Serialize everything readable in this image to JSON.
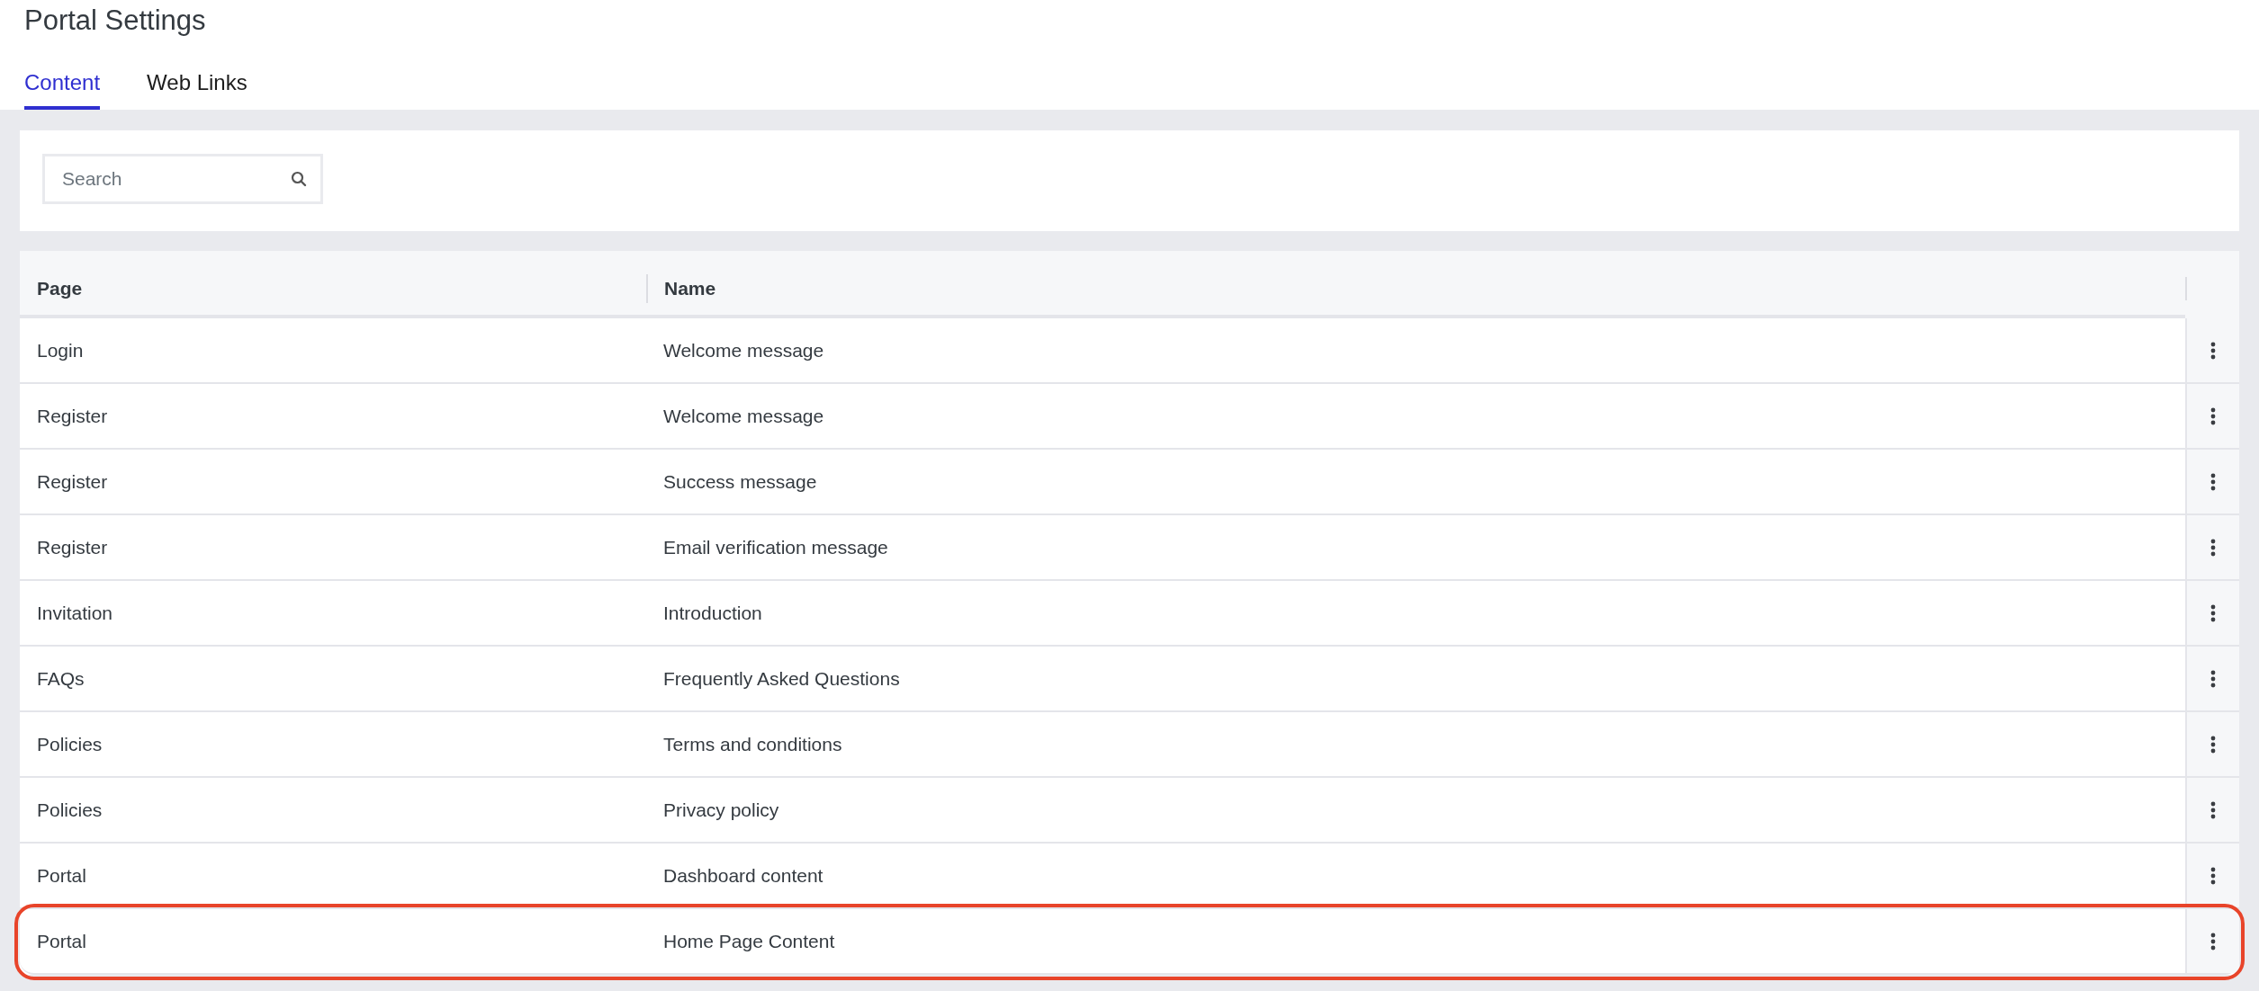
{
  "title": "Portal Settings",
  "tabs": [
    {
      "label": "Content",
      "selected": true
    },
    {
      "label": "Web Links",
      "selected": false
    }
  ],
  "search": {
    "placeholder": "Search"
  },
  "table": {
    "columns": [
      "Page",
      "Name"
    ],
    "rows": [
      {
        "page": "Login",
        "name": "Welcome message",
        "highlighted": false
      },
      {
        "page": "Register",
        "name": "Welcome message",
        "highlighted": false
      },
      {
        "page": "Register",
        "name": "Success message",
        "highlighted": false
      },
      {
        "page": "Register",
        "name": "Email verification message",
        "highlighted": false
      },
      {
        "page": "Invitation",
        "name": "Introduction",
        "highlighted": false
      },
      {
        "page": "FAQs",
        "name": "Frequently Asked Questions",
        "highlighted": false
      },
      {
        "page": "Policies",
        "name": "Terms and conditions",
        "highlighted": false
      },
      {
        "page": "Policies",
        "name": "Privacy policy",
        "highlighted": false
      },
      {
        "page": "Portal",
        "name": "Dashboard content",
        "highlighted": false
      },
      {
        "page": "Portal",
        "name": "Home Page Content",
        "highlighted": true
      }
    ]
  }
}
